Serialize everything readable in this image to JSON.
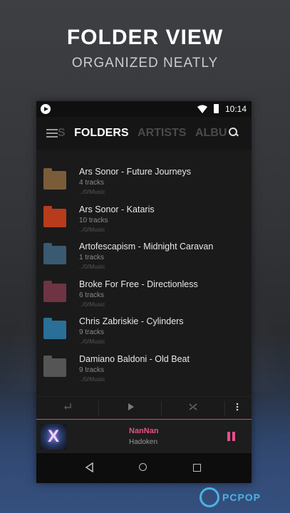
{
  "promo": {
    "title": "FOLDER VIEW",
    "subtitle": "ORGANIZED NEATLY"
  },
  "statusbar": {
    "time": "10:14",
    "icons": [
      "play-notification-icon",
      "wifi-icon",
      "battery-icon"
    ]
  },
  "appbar": {
    "tabs": [
      {
        "label": "S",
        "active": false
      },
      {
        "label": "FOLDERS",
        "active": true
      },
      {
        "label": "ARTISTS",
        "active": false
      },
      {
        "label": "ALBU",
        "active": false
      }
    ],
    "icons": [
      "menu-icon",
      "search-icon"
    ]
  },
  "folders": [
    {
      "title": "Ars Sonor - Future Journeys",
      "tracks": "4 tracks",
      "path": "../0/Music",
      "thumb_color": "#8a6a3a"
    },
    {
      "title": "Ars Sonor - Kataris",
      "tracks": "10 tracks",
      "path": "../0/Music",
      "thumb_color": "#c9401f"
    },
    {
      "title": "Artofescapism - Midnight Caravan",
      "tracks": "1 tracks",
      "path": "../0/Music",
      "thumb_color": "#3e5e7a"
    },
    {
      "title": "Broke For Free - Directionless",
      "tracks": "6 tracks",
      "path": "../0/Music",
      "thumb_color": "#7a3a4a"
    },
    {
      "title": "Chris Zabriskie - Cylinders",
      "tracks": "9 tracks",
      "path": "../0/Music",
      "thumb_color": "#2e7aa6"
    },
    {
      "title": "Damiano Baldoni - Old Beat",
      "tracks": "9 tracks",
      "path": "../0/Music",
      "thumb_color": "#5a5a5a"
    }
  ],
  "controls": {
    "icons": [
      "return-icon",
      "play-icon",
      "shuffle-icon",
      "more-icon"
    ]
  },
  "now_playing": {
    "title": "NanNan",
    "artist": "Hadoken",
    "icons": [
      "album-art-icon",
      "pause-icon"
    ]
  },
  "navbar": {
    "icons": [
      "back-icon",
      "home-icon",
      "recents-icon"
    ]
  },
  "watermark": {
    "text": "PCPOP"
  },
  "colors": {
    "accent": "#e6508a",
    "background": "#1a1a1a"
  }
}
